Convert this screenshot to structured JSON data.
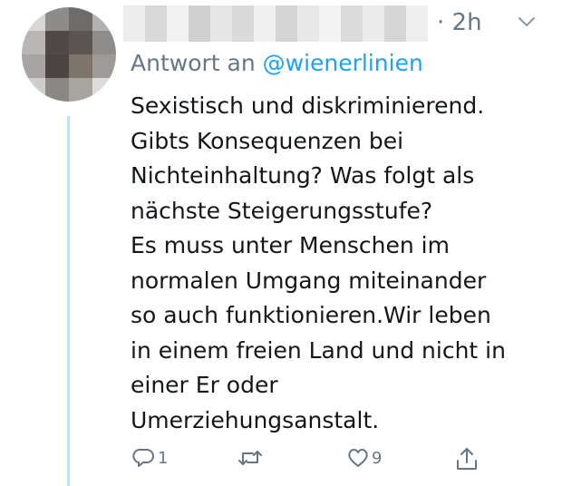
{
  "tweet": {
    "timestamp": "· 2h",
    "reply_prefix": "Antwort an",
    "reply_mention": "@wienerlinien",
    "text_lines": [
      "Sexistisch und diskriminierend.",
      "Gibts Konsequenzen bei",
      "Nichteinhaltung? Was folgt als",
      "nächste Steigerungsstufe?",
      "Es muss unter Menschen im",
      "normalen Umgang miteinander",
      "so auch funktionieren.Wir leben",
      "in einem freien Land und nicht in",
      "einer Er oder",
      "Umerziehungsanstalt."
    ]
  },
  "actions": {
    "reply_count": "1",
    "retweet_count": "",
    "like_count": "9"
  },
  "colors": {
    "accent": "#1da1f2",
    "muted": "#657786",
    "text": "#14171a",
    "thread_line": "#c4e0f5"
  },
  "icons": [
    "reply-icon",
    "retweet-icon",
    "like-icon",
    "share-icon",
    "chevron-down-icon"
  ]
}
